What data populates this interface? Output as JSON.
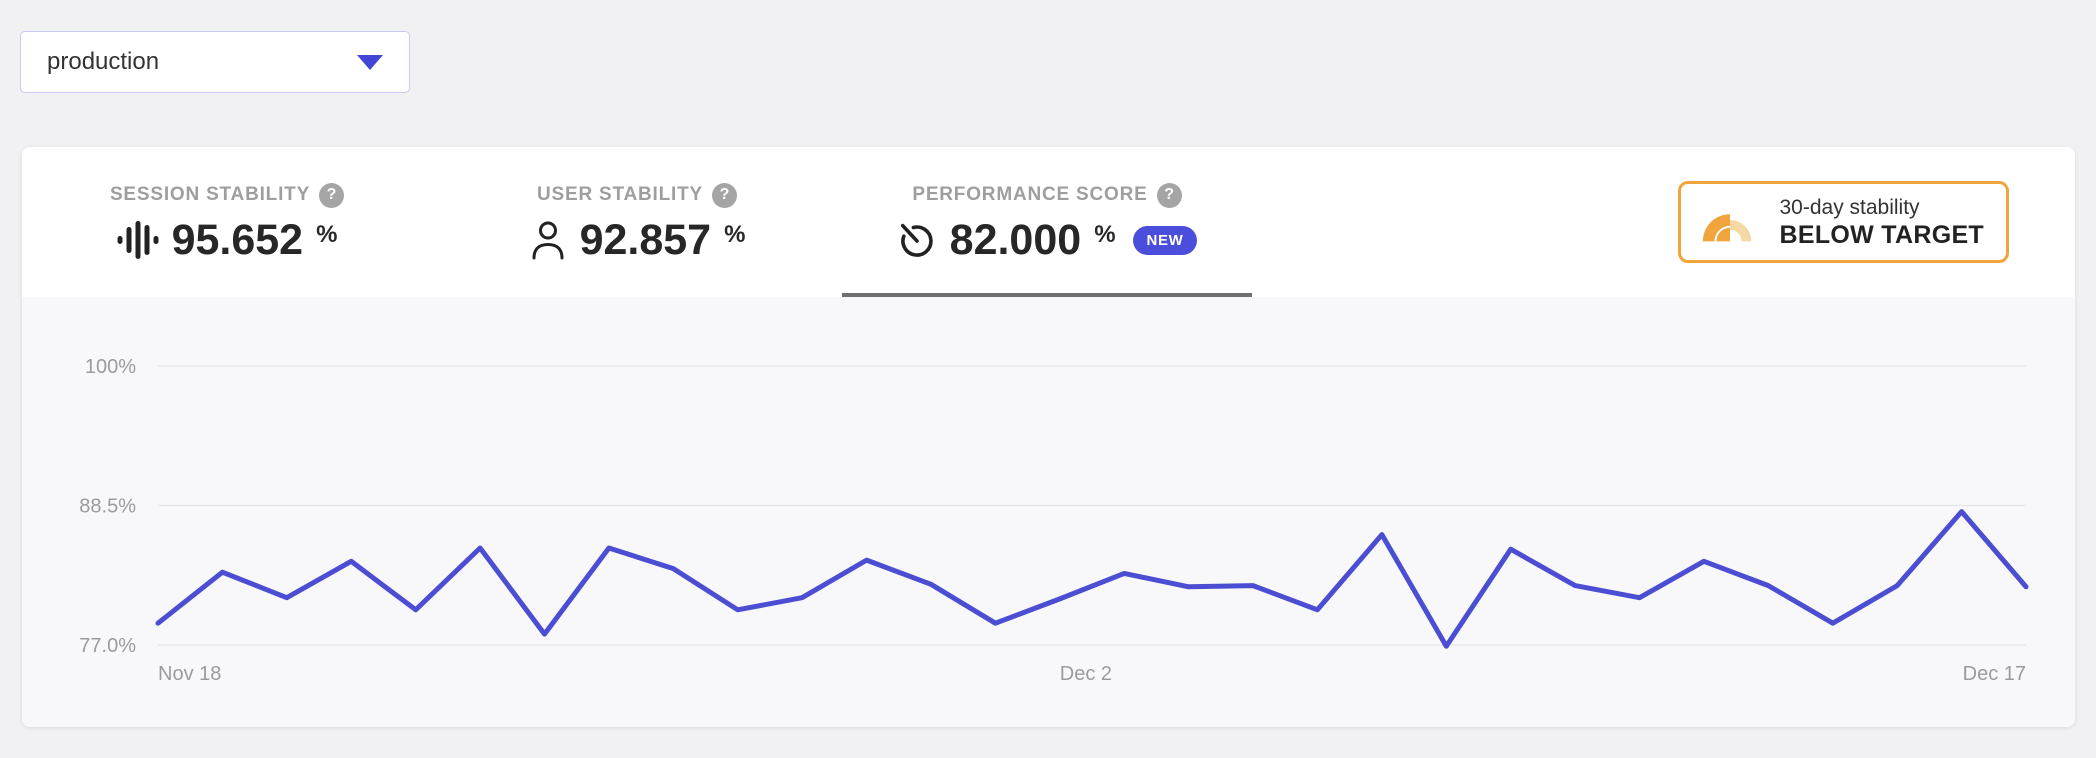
{
  "env_selector": {
    "value": "production"
  },
  "header": {
    "stats": [
      {
        "label": "SESSION STABILITY",
        "value": "95.652",
        "unit": "%",
        "help_icon": "?",
        "icon": "waveform-icon",
        "active": false
      },
      {
        "label": "USER STABILITY",
        "value": "92.857",
        "unit": "%",
        "help_icon": "?",
        "icon": "user-icon",
        "active": false
      },
      {
        "label": "PERFORMANCE SCORE",
        "value": "82.000",
        "unit": "%",
        "help_icon": "?",
        "icon": "gauge-icon",
        "badge": "NEW",
        "active": true
      }
    ],
    "target_badge": {
      "icon": "stability-meter-icon",
      "line1": "30-day stability",
      "line2": "BELOW TARGET"
    }
  },
  "colors": {
    "accent_indigo": "#4b4ed6",
    "line": "#4b4ed2",
    "badge_new_bg": "#4b4edb",
    "warning_orange": "#f0a43c",
    "warning_orange_light": "#f5d8a3",
    "active_tab_underline": "#6e6e6e",
    "axis_text": "#9b9b9b",
    "gridline": "#e8e8e9",
    "chart_bg": "#f8f8fa"
  },
  "chart_data": {
    "type": "line",
    "title": "",
    "xlabel": "",
    "ylabel": "",
    "legend": "none",
    "grid": "horizontal-only",
    "x_range_days": 30,
    "series": [
      {
        "name": "Performance score",
        "values": [
          78.8,
          83.0,
          80.9,
          83.9,
          79.9,
          85.0,
          77.9,
          85.0,
          83.3,
          79.9,
          80.9,
          84.0,
          82.0,
          78.8,
          80.8,
          82.9,
          81.8,
          81.9,
          79.9,
          86.1,
          76.9,
          84.9,
          81.9,
          80.9,
          83.9,
          81.9,
          78.8,
          81.9,
          88.0,
          81.8
        ]
      }
    ],
    "x_ticks": [
      {
        "index": 0,
        "label": "Nov 18"
      },
      {
        "index": 14,
        "label": "Dec 2"
      },
      {
        "index": 29,
        "label": "Dec 17"
      }
    ],
    "y_ticks": [
      {
        "value": 100,
        "label": "100%"
      },
      {
        "value": 88.5,
        "label": "88.5%"
      },
      {
        "value": 77,
        "label": "77.0%"
      }
    ]
  }
}
